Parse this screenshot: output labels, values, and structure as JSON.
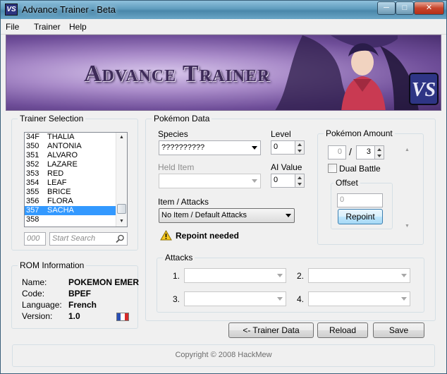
{
  "window": {
    "title": "Advance Trainer - Beta",
    "icon_text": "VS"
  },
  "menu": [
    "File",
    "Trainer",
    "Help"
  ],
  "banner": {
    "title": "Advance Trainer",
    "logo": "VS"
  },
  "trainer_selection": {
    "title": "Trainer Selection",
    "rows": [
      {
        "num": "34F",
        "name": "THALIA"
      },
      {
        "num": "350",
        "name": "ANTONIA"
      },
      {
        "num": "351",
        "name": "ALVARO"
      },
      {
        "num": "352",
        "name": "LAZARE"
      },
      {
        "num": "353",
        "name": "RED"
      },
      {
        "num": "354",
        "name": "LEAF"
      },
      {
        "num": "355",
        "name": "BRICE"
      },
      {
        "num": "356",
        "name": "FLORA"
      },
      {
        "num": "357",
        "name": "SACHA"
      },
      {
        "num": "358",
        "name": ""
      }
    ],
    "selected_index": 8,
    "number_placeholder": "000",
    "search_placeholder": "Start Search"
  },
  "rom_info": {
    "title": "ROM Information",
    "name_label": "Name:",
    "name_value": "POKEMON EMER",
    "code_label": "Code:",
    "code_value": "BPEF",
    "language_label": "Language:",
    "language_value": "French",
    "version_label": "Version:",
    "version_value": "1.0",
    "flag_colors": [
      "#2a4fb5",
      "#ffffff",
      "#d62a2a"
    ]
  },
  "pokemon_data": {
    "title": "Pokémon Data",
    "species_label": "Species",
    "species_value": "??????????",
    "level_label": "Level",
    "level_value": "0",
    "held_item_label": "Held Item",
    "held_item_value": "",
    "ai_value_label": "AI Value",
    "ai_value": "0",
    "item_attacks_label": "Item / Attacks",
    "item_attacks_value": "No Item / Default Attacks",
    "warning": "Repoint needed"
  },
  "pokemon_amount": {
    "title": "Pokémon Amount",
    "current": "0",
    "separator": "/",
    "max": "3",
    "dual_battle_label": "Dual Battle",
    "dual_battle_checked": false,
    "offset_label": "Offset",
    "offset_value": "0",
    "repoint_label": "Repoint"
  },
  "attacks": {
    "title": "Attacks",
    "slots": [
      "1.",
      "2.",
      "3.",
      "4."
    ]
  },
  "buttons": {
    "trainer_data": "<- Trainer Data",
    "reload": "Reload",
    "save": "Save"
  },
  "footer": {
    "copyright": "Copyright © 2008 HackMew"
  }
}
